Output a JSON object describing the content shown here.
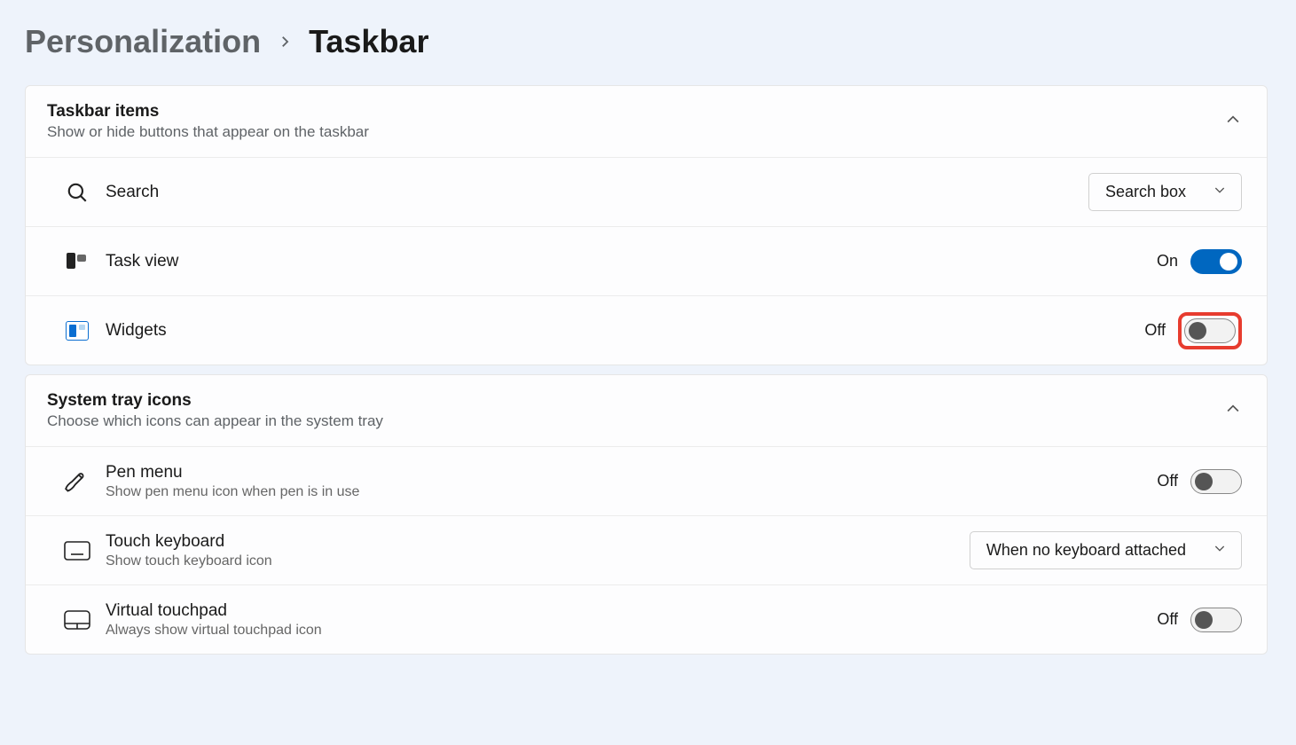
{
  "breadcrumb": {
    "parent": "Personalization",
    "current": "Taskbar"
  },
  "sections": {
    "taskbar_items": {
      "title": "Taskbar items",
      "subtitle": "Show or hide buttons that appear on the taskbar",
      "search": {
        "label": "Search",
        "select_value": "Search box"
      },
      "taskview": {
        "label": "Task view",
        "state": "On"
      },
      "widgets": {
        "label": "Widgets",
        "state": "Off"
      }
    },
    "system_tray": {
      "title": "System tray icons",
      "subtitle": "Choose which icons can appear in the system tray",
      "pen": {
        "label": "Pen menu",
        "sub": "Show pen menu icon when pen is in use",
        "state": "Off"
      },
      "touchkb": {
        "label": "Touch keyboard",
        "sub": "Show touch keyboard icon",
        "select_value": "When no keyboard attached"
      },
      "touchpad": {
        "label": "Virtual touchpad",
        "sub": "Always show virtual touchpad icon",
        "state": "Off"
      }
    }
  }
}
